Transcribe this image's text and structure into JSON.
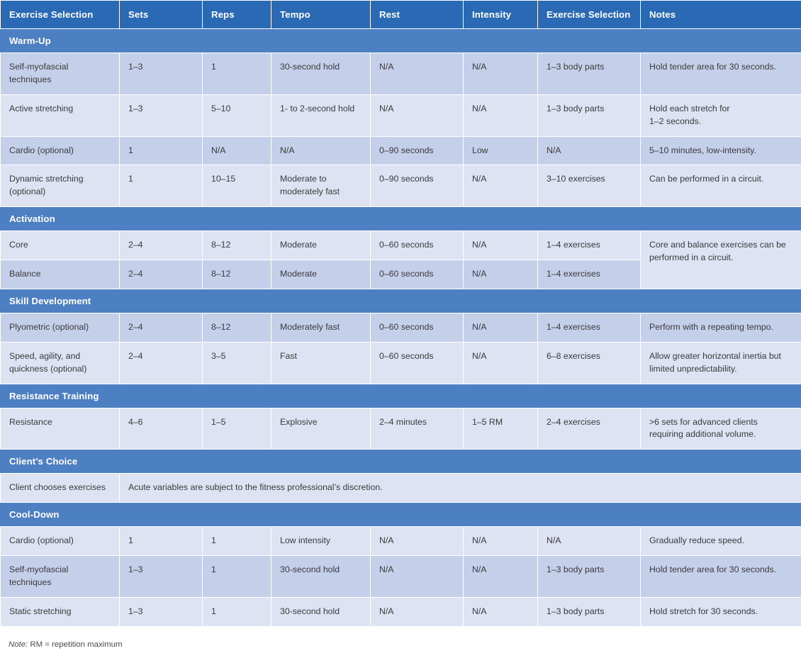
{
  "table": {
    "columns": [
      "Exercise Selection",
      "Sets",
      "Reps",
      "Tempo",
      "Rest",
      "Intensity",
      "Exercise Selection",
      "Notes"
    ],
    "sections": [
      {
        "title": "Warm-Up",
        "rows": [
          {
            "shade": "dark",
            "cells": [
              "Self-myofascial techniques",
              "1–3",
              "1",
              "30-second hold",
              "N/A",
              "N/A",
              "1–3 body parts",
              "Hold tender area for 30 seconds."
            ]
          },
          {
            "shade": "light",
            "cells": [
              "Active stretching",
              "1–3",
              "5–10",
              "1- to 2-second hold",
              "N/A",
              "N/A",
              "1–3 body parts",
              "Hold each stretch for\n1–2 seconds."
            ]
          },
          {
            "shade": "dark",
            "cells": [
              "Cardio (optional)",
              "1",
              "N/A",
              "N/A",
              "0–90 seconds",
              "Low",
              "N/A",
              "5–10 minutes, low-intensity."
            ]
          },
          {
            "shade": "light",
            "cells": [
              "Dynamic stretching (optional)",
              "1",
              "10–15",
              "Moderate to moderately fast",
              "0–90 seconds",
              "N/A",
              "3–10 exercises",
              "Can be performed in a circuit."
            ]
          }
        ]
      },
      {
        "title": "Activation",
        "merged_note": "Core and balance exercises can be performed in a circuit.",
        "rows": [
          {
            "shade": "light",
            "cells": [
              "Core",
              "2–4",
              "8–12",
              "Moderate",
              "0–60 seconds",
              "N/A",
              "1–4 exercises"
            ]
          },
          {
            "shade": "dark",
            "cells": [
              "Balance",
              "2–4",
              "8–12",
              "Moderate",
              "0–60 seconds",
              "N/A",
              "1–4 exercises"
            ]
          }
        ]
      },
      {
        "title": "Skill Development",
        "rows": [
          {
            "shade": "dark",
            "cells": [
              "Plyometric (optional)",
              "2–4",
              "8–12",
              "Moderately fast",
              "0–60 seconds",
              "N/A",
              "1–4 exercises",
              "Perform with a repeating tempo."
            ]
          },
          {
            "shade": "light",
            "cells": [
              "Speed, agility, and quickness (optional)",
              "2–4",
              "3–5",
              "Fast",
              "0–60 seconds",
              "N/A",
              "6–8 exercises",
              "Allow greater horizontal inertia but limited unpredictability."
            ]
          }
        ]
      },
      {
        "title": "Resistance Training",
        "rows": [
          {
            "shade": "light",
            "cells": [
              "Resistance",
              "4–6",
              "1–5",
              "Explosive",
              "2–4 minutes",
              "1–5 RM",
              "2–4 exercises",
              ">6 sets for advanced clients requiring additional volume."
            ]
          }
        ]
      },
      {
        "title": "Client’s Choice",
        "rows": [
          {
            "shade": "light",
            "span_row": true,
            "cells": [
              "Client chooses exercises",
              "Acute variables are subject to the fitness professional’s discretion."
            ]
          }
        ]
      },
      {
        "title": "Cool-Down",
        "rows": [
          {
            "shade": "light",
            "cells": [
              "Cardio (optional)",
              "1",
              "1",
              "Low intensity",
              "N/A",
              "N/A",
              "N/A",
              "Gradually reduce speed."
            ]
          },
          {
            "shade": "dark",
            "cells": [
              "Self-myofascial techniques",
              "1–3",
              "1",
              "30-second hold",
              "N/A",
              "N/A",
              "1–3 body parts",
              "Hold tender area for 30 seconds."
            ]
          },
          {
            "shade": "light",
            "cells": [
              "Static stretching",
              "1–3",
              "1",
              "30-second hold",
              "N/A",
              "N/A",
              "1–3 body parts",
              "Hold stretch for 30 seconds."
            ]
          }
        ]
      }
    ]
  },
  "footnote": {
    "label": "Note:",
    "text": "RM = repetition maximum"
  },
  "colors": {
    "header_blue": "#2a6ab5",
    "section_blue": "#4d80c2",
    "row_dark": "#c4cfe9",
    "row_light": "#dde3f2",
    "text": "#3a3a3a",
    "grid": "#ffffff"
  }
}
